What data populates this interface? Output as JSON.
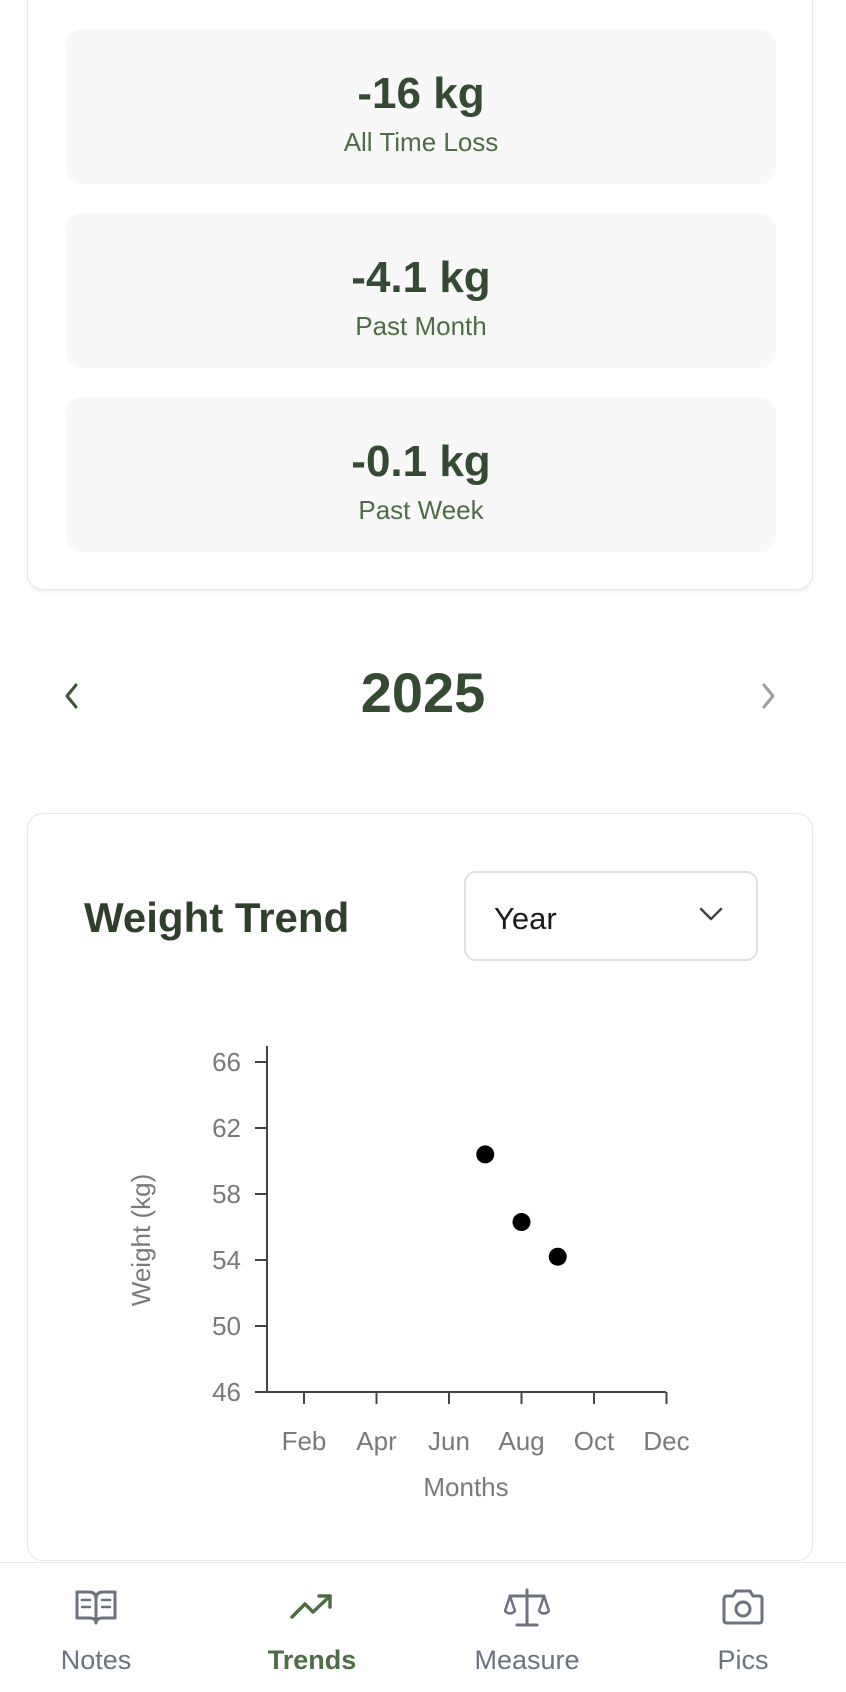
{
  "stats": [
    {
      "value": "-16 kg",
      "label": "All Time Loss"
    },
    {
      "value": "-4.1 kg",
      "label": "Past Month"
    },
    {
      "value": "-0.1 kg",
      "label": "Past Week"
    }
  ],
  "year_nav": {
    "year": "2025",
    "prev_icon": "chevron-left-icon",
    "next_icon": "chevron-right-icon"
  },
  "chart_card": {
    "title": "Weight Trend",
    "range_select": {
      "value": "Year",
      "icon": "chevron-down-icon"
    }
  },
  "chart_data": {
    "type": "scatter",
    "xlabel": "Months",
    "ylabel": "Weight (kg)",
    "x_ticks": [
      "Feb",
      "Apr",
      "Jun",
      "Aug",
      "Oct",
      "Dec"
    ],
    "y_ticks": [
      "66",
      "62",
      "58",
      "54",
      "50",
      "46"
    ],
    "ylim": [
      46,
      67
    ],
    "xlim": [
      "Jan",
      "Dec"
    ],
    "points": [
      {
        "x": "Jul",
        "y": 60.4
      },
      {
        "x": "Aug",
        "y": 56.3
      },
      {
        "x": "Sep",
        "y": 54.2
      }
    ],
    "grid": false,
    "point_color": "#000000"
  },
  "bottom_nav": {
    "items": [
      {
        "label": "Notes",
        "icon": "book-open-icon",
        "active": false
      },
      {
        "label": "Trends",
        "icon": "trending-up-icon",
        "active": true
      },
      {
        "label": "Measure",
        "icon": "scale-icon",
        "active": false
      },
      {
        "label": "Pics",
        "icon": "camera-icon",
        "active": false
      }
    ]
  },
  "colors": {
    "primary_green": "#344a32",
    "accent_green": "#4e6d44",
    "inactive_gray": "#6b7280",
    "stat_box_bg": "#f8f8f8"
  }
}
